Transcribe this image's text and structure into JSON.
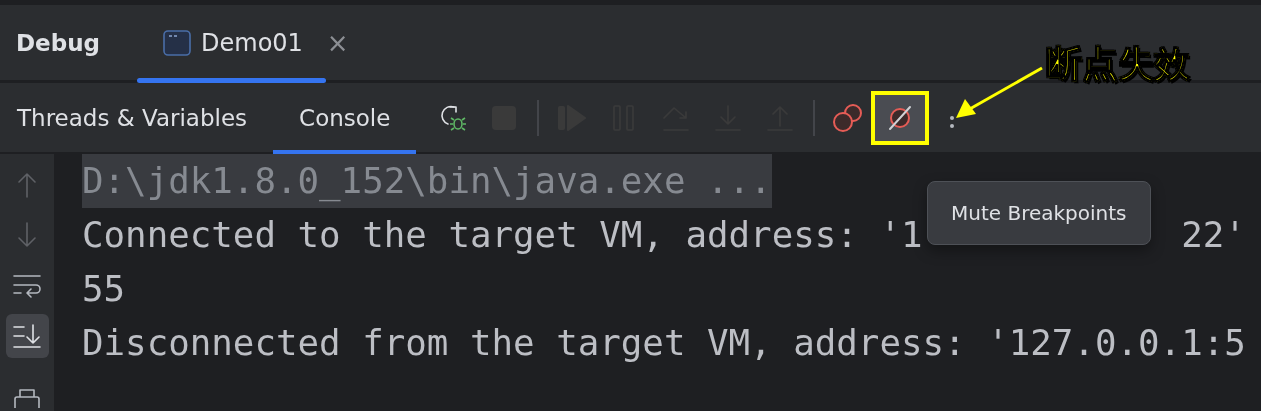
{
  "header": {
    "title": "Debug",
    "tabs": [
      {
        "label": "Demo01",
        "selected": true,
        "close": "×"
      }
    ]
  },
  "subtabs": [
    {
      "label": "Threads & Variables",
      "selected": false
    },
    {
      "label": "Console",
      "selected": true
    }
  ],
  "toolbar": [
    {
      "kind": "rerun",
      "disabled": false,
      "on": false
    },
    {
      "kind": "stop",
      "disabled": true,
      "on": false
    },
    {
      "kind": "separator"
    },
    {
      "kind": "resume",
      "disabled": true,
      "on": false
    },
    {
      "kind": "pause",
      "disabled": true,
      "on": false
    },
    {
      "kind": "step-over",
      "disabled": true,
      "on": false
    },
    {
      "kind": "step-into",
      "disabled": true,
      "on": false
    },
    {
      "kind": "step-out",
      "disabled": true,
      "on": false
    },
    {
      "kind": "separator"
    },
    {
      "kind": "breakpoints",
      "disabled": false,
      "on": false
    },
    {
      "kind": "mute",
      "disabled": false,
      "on": true
    },
    {
      "kind": "more",
      "disabled": false,
      "on": false
    }
  ],
  "gutter": [
    {
      "kind": "up",
      "on": false,
      "disabled": true
    },
    {
      "kind": "down",
      "on": false,
      "disabled": true
    },
    {
      "kind": "wrap",
      "on": false,
      "disabled": false
    },
    {
      "kind": "scroll-end",
      "on": true,
      "disabled": false
    },
    {
      "kind": "print",
      "on": false,
      "disabled": false
    }
  ],
  "console": [
    {
      "text": "D:\\jdk1.8.0_152\\bin\\java.exe ...",
      "folded": true
    },
    {
      "text": "Connected to the target VM, address: '1",
      "after_tooltip": "22'",
      "folded": false
    },
    {
      "text": "55",
      "folded": false
    },
    {
      "text": "Disconnected from the target VM, address: '127.0.0.1:5",
      "folded": false
    }
  ],
  "tooltip": {
    "text": "Mute Breakpoints"
  },
  "annotation": {
    "label": "断点失效"
  }
}
